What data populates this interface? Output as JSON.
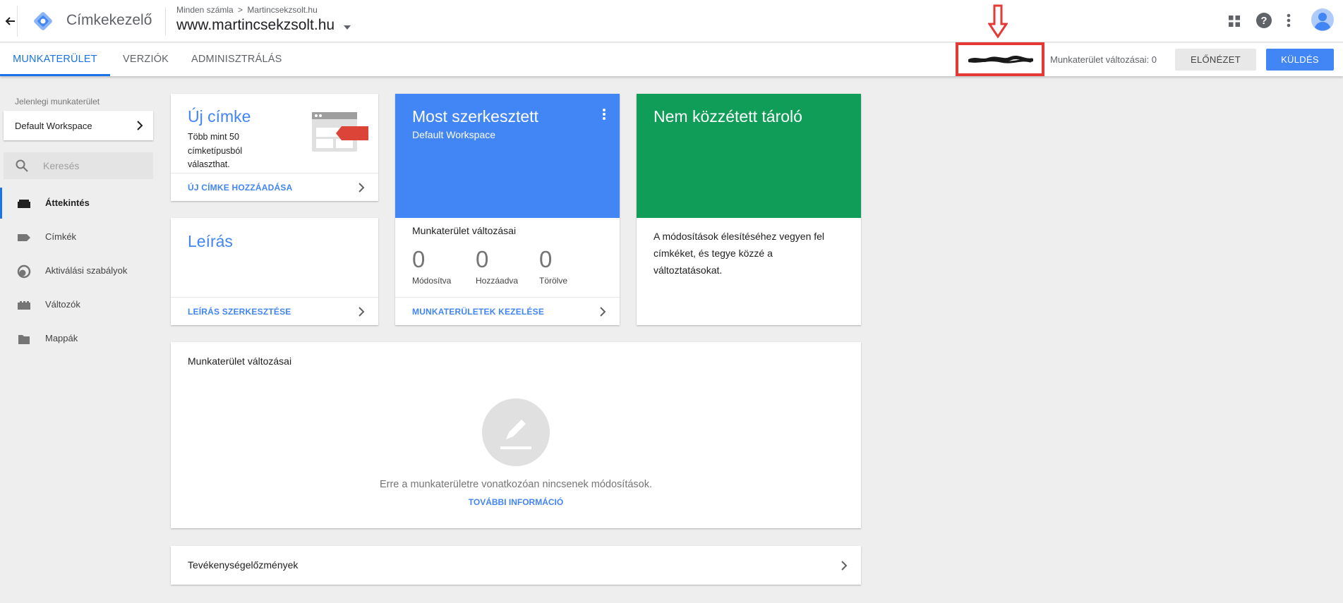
{
  "header": {
    "app_name": "Címkekezelő",
    "breadcrumb_all": "Minden számla",
    "breadcrumb_sep": ">",
    "breadcrumb_account": "Martincsekzsolt.hu",
    "container_name": "www.martincsekzsolt.hu"
  },
  "tabs": [
    {
      "label": "MUNKATERÜLET",
      "active": true
    },
    {
      "label": "VERZIÓK",
      "active": false
    },
    {
      "label": "ADMINISZTRÁLÁS",
      "active": false
    }
  ],
  "toolbar": {
    "changes_label": "Munkaterület változásai: 0",
    "preview_label": "ELŐNÉZET",
    "submit_label": "KÜLDÉS",
    "submit_color": "#4285f4",
    "highlight_color": "#e53935"
  },
  "sidebar": {
    "workspace_caption": "Jelenlegi munkaterület",
    "workspace_name": "Default Workspace",
    "search_placeholder": "Keresés",
    "items": [
      {
        "label": "Áttekintés",
        "icon": "overview-icon",
        "active": true
      },
      {
        "label": "Címkék",
        "icon": "tag-icon",
        "active": false
      },
      {
        "label": "Aktiválási szabályok",
        "icon": "trigger-icon",
        "active": false
      },
      {
        "label": "Változók",
        "icon": "variable-icon",
        "active": false
      },
      {
        "label": "Mappák",
        "icon": "folder-icon",
        "active": false
      }
    ]
  },
  "new_tag_card": {
    "title": "Új címke",
    "desc_line1": "Több mint 50",
    "desc_line2": "címketípusból",
    "desc_line3": "választhat.",
    "link": "ÚJ CÍMKE HOZZÁADÁSA"
  },
  "description_card": {
    "title": "Leírás",
    "link": "LEÍRÁS SZERKESZTÉSE"
  },
  "edited_card": {
    "title": "Most szerkesztett",
    "subtitle": "Default Workspace",
    "color": "#4285f4",
    "section_title": "Munkaterület változásai",
    "stats": [
      {
        "value": "0",
        "label": "Módosítva"
      },
      {
        "value": "0",
        "label": "Hozzáadva"
      },
      {
        "value": "0",
        "label": "Törölve"
      }
    ],
    "link": "MUNKATERÜLETEK KEZELÉSE"
  },
  "unpublished_card": {
    "title": "Nem közzétett tároló",
    "color": "#0f9d58",
    "body_line1": "A módosítások élesítéséhez vegyen fel",
    "body_line2": "címkéket, és tegye közzé a",
    "body_line3": "változtatásokat."
  },
  "changes_card": {
    "title": "Munkaterület változásai",
    "empty_text": "Erre a munkaterületre vonatkozóan nincsenek módosítások.",
    "more_link": "TOVÁBBI INFORMÁCIÓ"
  },
  "activity_card": {
    "title": "Tevékenységelőzmények"
  }
}
